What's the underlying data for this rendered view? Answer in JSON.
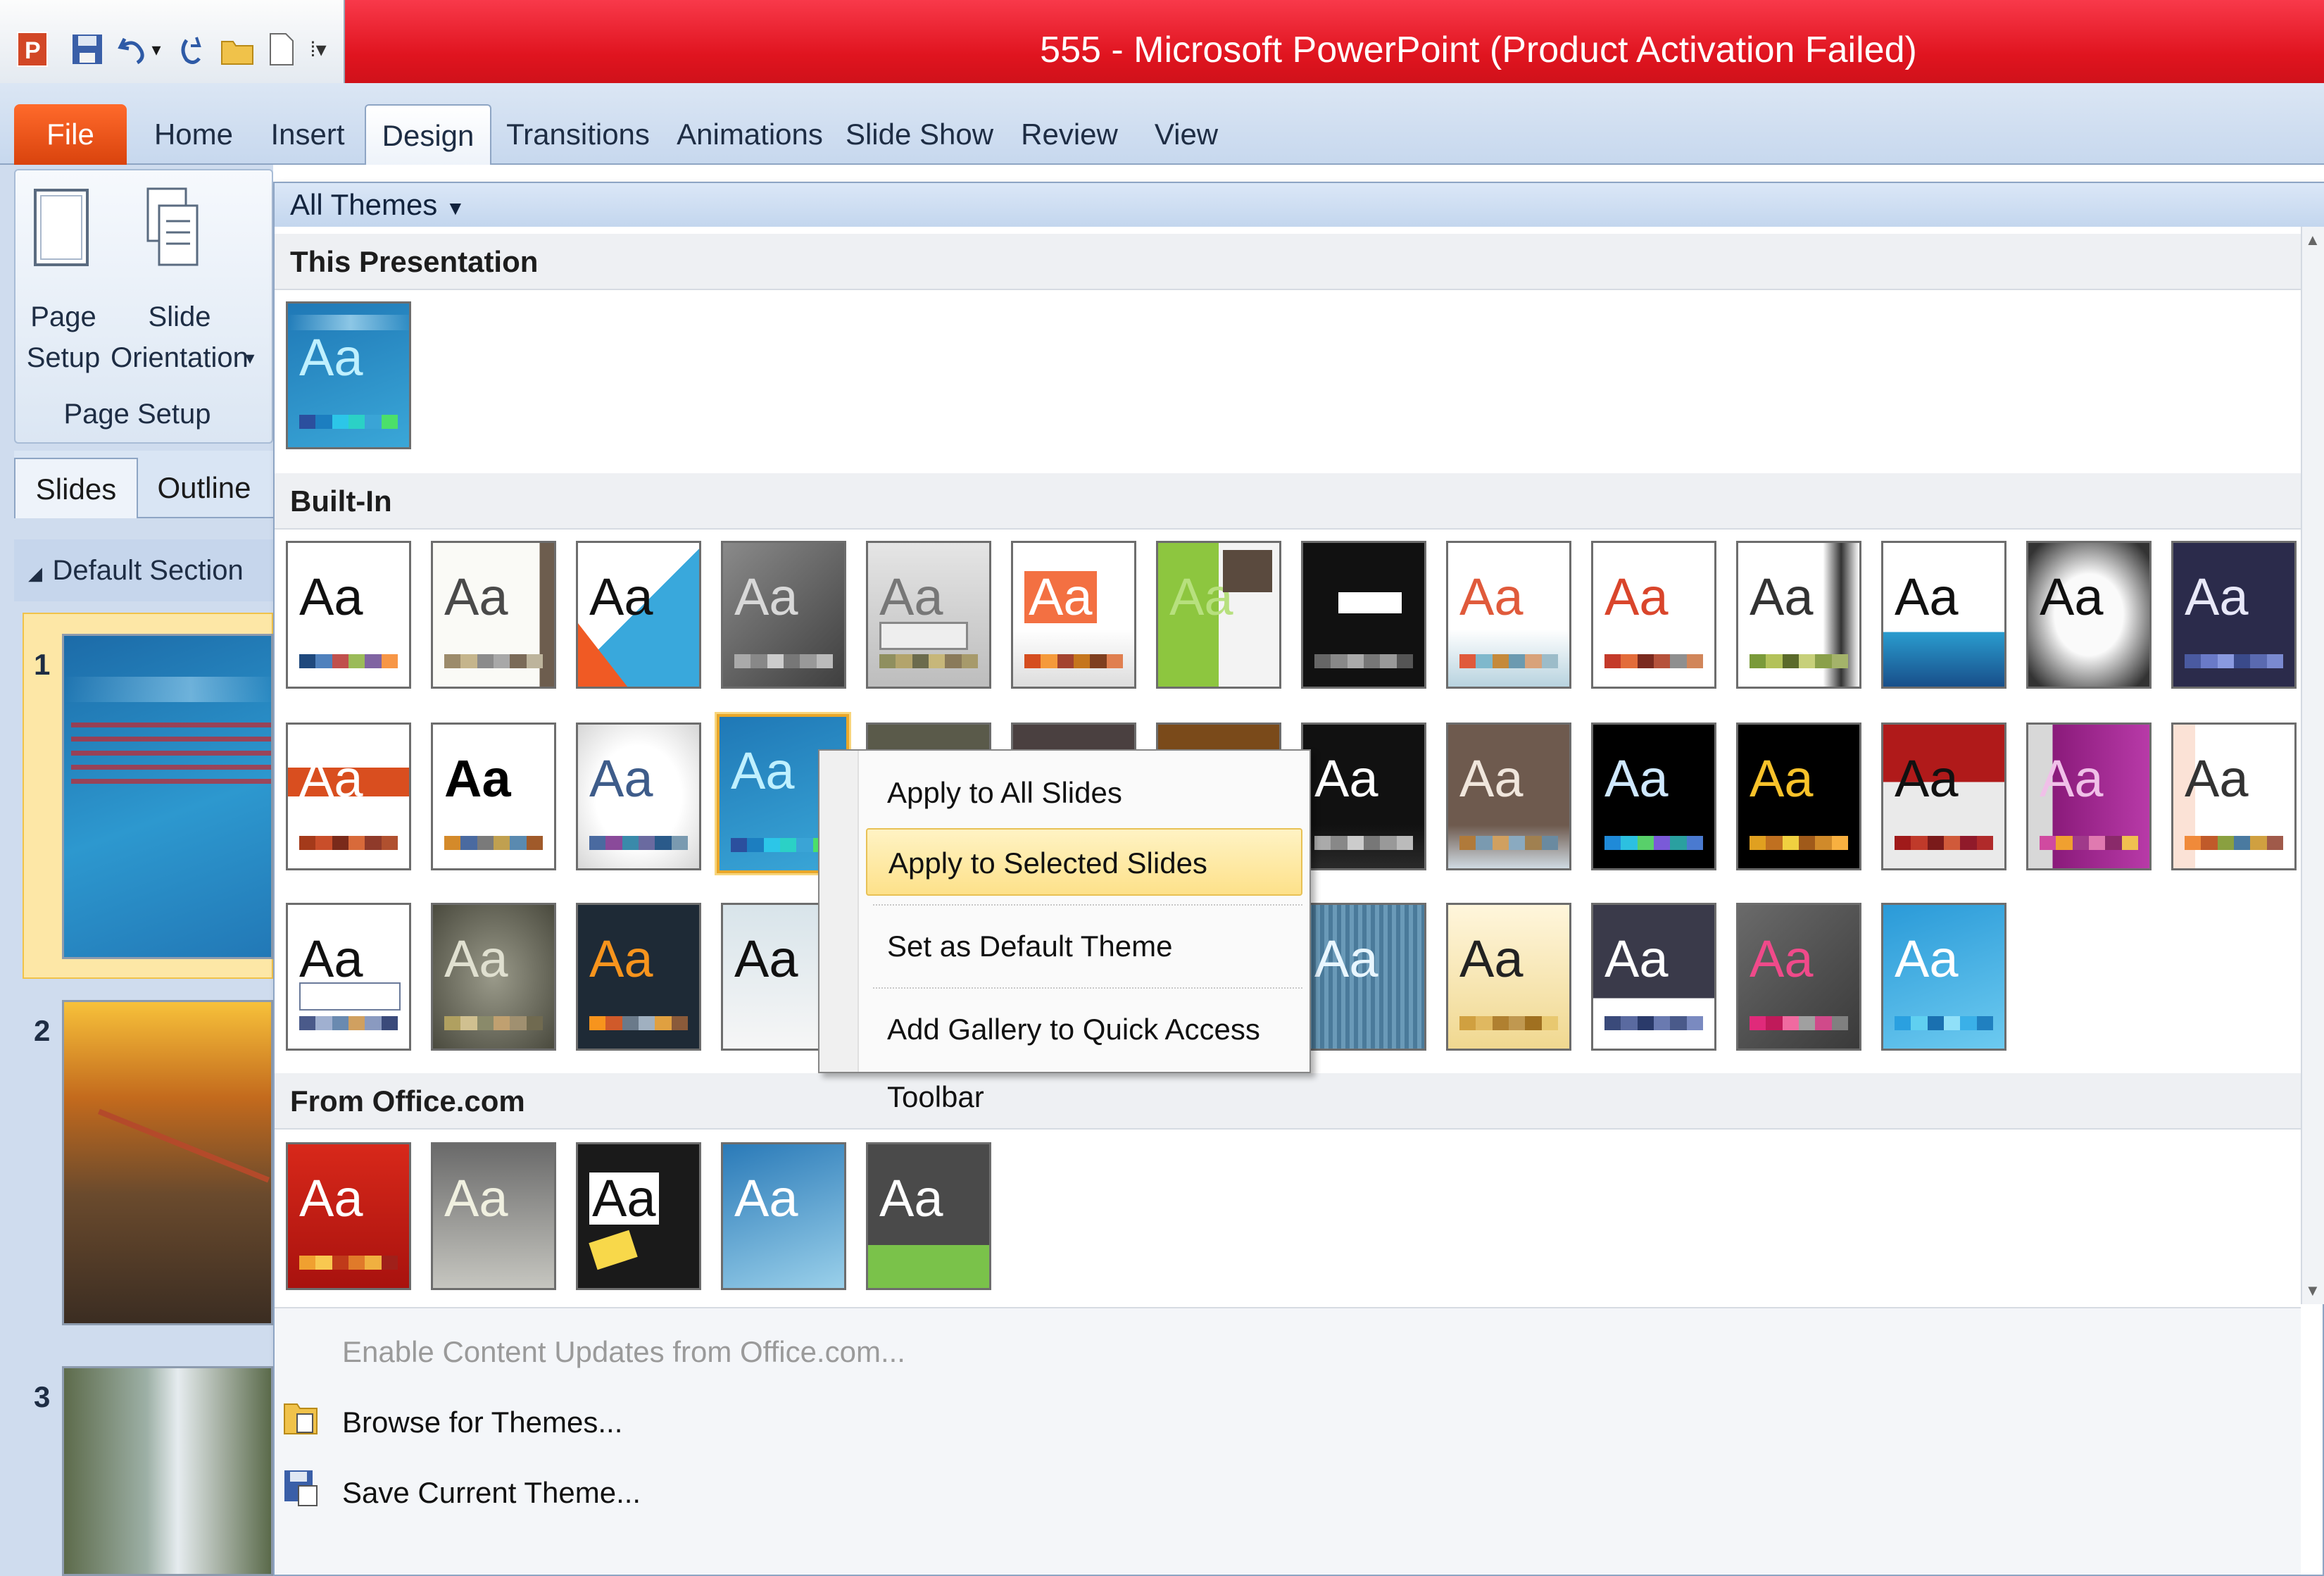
{
  "window": {
    "title": "555 - Microsoft PowerPoint (Product Activation Failed)"
  },
  "ribbon": {
    "tabs": [
      "File",
      "Home",
      "Insert",
      "Design",
      "Transitions",
      "Animations",
      "Slide Show",
      "Review",
      "View"
    ],
    "active_tab": "Design",
    "page_setup_group": {
      "page_setup_label_1": "Page",
      "page_setup_label_2": "Setup",
      "slide_orientation_label_1": "Slide",
      "slide_orientation_label_2": "Orientation",
      "group_name": "Page Setup"
    }
  },
  "left_panel": {
    "tabs": [
      "Slides",
      "Outline"
    ],
    "section_name": "Default Section",
    "slide_numbers": [
      "1",
      "2",
      "3"
    ]
  },
  "gallery": {
    "filter_label": "All Themes",
    "sections": {
      "this_presentation": "This Presentation",
      "built_in": "Built-In",
      "from_office": "From Office.com"
    },
    "tile_sample_text": "Aa"
  },
  "context_menu": {
    "items": [
      "Apply to All Slides",
      "Apply to Selected Slides",
      "Set as Default Theme",
      "Add Gallery to Quick Access Toolbar"
    ],
    "highlighted_index": 1
  },
  "bottom_commands": {
    "enable_updates": "Enable Content Updates from Office.com...",
    "browse_themes": "Browse for Themes...",
    "save_theme": "Save Current Theme..."
  },
  "colors": {
    "title_bar": "#e0141f",
    "file_tab": "#d9430d",
    "highlight": "#fde18a",
    "ribbon": "#c7d8ee"
  },
  "icons": [
    "powerpoint-logo-icon",
    "save-icon",
    "undo-icon",
    "redo-icon",
    "open-icon",
    "new-icon",
    "customize-qat-icon",
    "page-setup-icon",
    "slide-orientation-icon",
    "browse-themes-icon",
    "save-theme-icon",
    "scroll-up-icon",
    "scroll-down-icon"
  ]
}
